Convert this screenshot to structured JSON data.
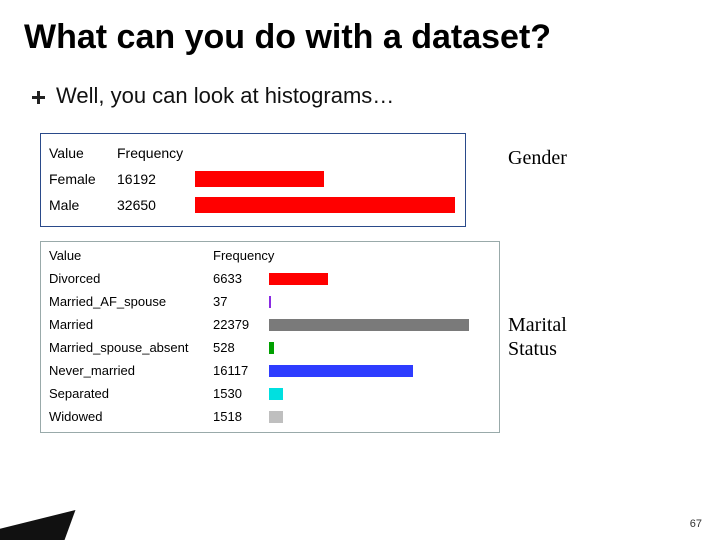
{
  "title": "What can you do with a dataset?",
  "subtitle": "Well, you can look at histograms…",
  "labels": {
    "gender": "Gender",
    "marital": "Marital\nStatus"
  },
  "page_number": "67",
  "chart_data": [
    {
      "type": "bar",
      "title": "Gender",
      "header_value": "Value",
      "header_freq": "Frequency",
      "max": 32650,
      "rows": [
        {
          "value": "Female",
          "freq": 16192,
          "color": "#ff0000"
        },
        {
          "value": "Male",
          "freq": 32650,
          "color": "#ff0000"
        }
      ]
    },
    {
      "type": "bar",
      "title": "Marital Status",
      "header_value": "Value",
      "header_freq": "Frequency",
      "max": 22379,
      "rows": [
        {
          "value": "Divorced",
          "freq": 6633,
          "color": "#ff0000"
        },
        {
          "value": "Married_AF_spouse",
          "freq": 37,
          "color": "#8a2be2"
        },
        {
          "value": "Married",
          "freq": 22379,
          "color": "#7a7a7a"
        },
        {
          "value": "Married_spouse_absent",
          "freq": 528,
          "color": "#00a000"
        },
        {
          "value": "Never_married",
          "freq": 16117,
          "color": "#2e3cff"
        },
        {
          "value": "Separated",
          "freq": 1530,
          "color": "#00e0e0"
        },
        {
          "value": "Widowed",
          "freq": 1518,
          "color": "#bfbfbf"
        }
      ]
    }
  ]
}
